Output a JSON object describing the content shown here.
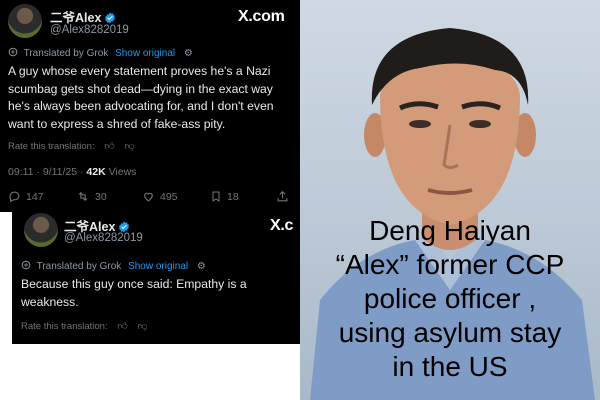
{
  "tweet1": {
    "display_name": "二爷Alex",
    "handle": "@Alex8282019",
    "x_logo": "X.com",
    "translated_label": "Translated by Grok",
    "show_original": "Show original",
    "body_lines": [
      "A guy whose every statement proves he's a Nazi",
      "scumbag gets shot dead—dying in the exact way",
      "he's always been advocating for, and I don't even",
      "want to express a shred of fake-ass pity."
    ],
    "rate_label": "Rate this translation:",
    "timestamp": "09:11 · 9/11/25 ·",
    "views_count": "42K",
    "views_label": "Views",
    "replies": "147",
    "reposts": "30",
    "likes": "495",
    "bookmarks": "18"
  },
  "tweet2": {
    "display_name": "二爷Alex",
    "handle": "@Alex8282019",
    "x_logo": "X.c",
    "translated_label": "Translated by Grok",
    "show_original": "Show original",
    "body_lines": [
      "Because this guy once said: Empathy is a",
      "weakness."
    ],
    "rate_label": "Rate this translation:"
  },
  "photo": {
    "caption_lines": [
      "Deng Haiyan",
      "“Alex” former CCP",
      "police officer ,",
      "using asylum stay",
      "in the US"
    ]
  },
  "colors": {
    "card_bg": "#000000",
    "text": "#e7e9ea",
    "muted": "#71767b",
    "link": "#1d9bf0"
  },
  "icons": [
    "verified-badge-icon",
    "translate-icon",
    "gear-icon",
    "thumbs-up-icon",
    "thumbs-down-icon",
    "reply-icon",
    "repost-icon",
    "like-icon",
    "bookmark-icon",
    "share-icon"
  ]
}
